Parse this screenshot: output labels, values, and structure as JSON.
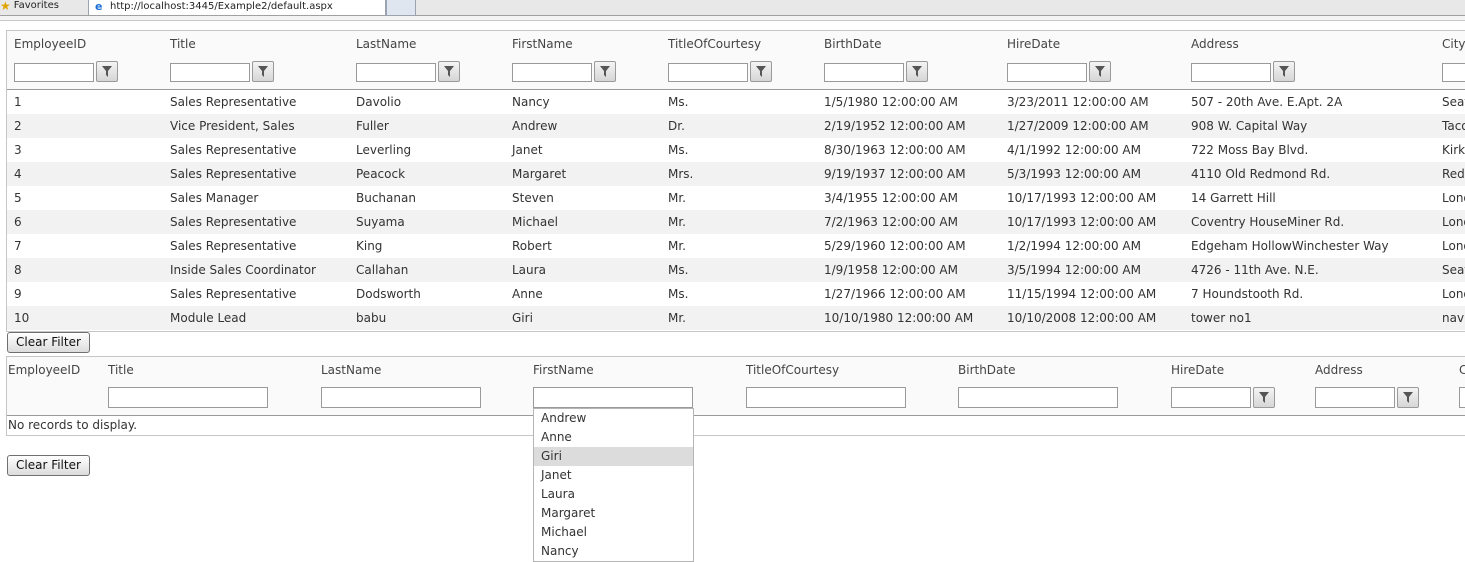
{
  "browser": {
    "favorites_label": "Favorites",
    "tab_url": "http://localhost:3445/Example2/default.aspx"
  },
  "grid1": {
    "columns": [
      "EmployeeID",
      "Title",
      "LastName",
      "FirstName",
      "TitleOfCourtesy",
      "BirthDate",
      "HireDate",
      "Address",
      "City"
    ],
    "rows": [
      [
        "1",
        "Sales Representative",
        "Davolio",
        "Nancy",
        "Ms.",
        "1/5/1980 12:00:00 AM",
        "3/23/2011 12:00:00 AM",
        "507 - 20th Ave. E.Apt. 2A",
        "Seattle"
      ],
      [
        "2",
        "Vice President, Sales",
        "Fuller",
        "Andrew",
        "Dr.",
        "2/19/1952 12:00:00 AM",
        "1/27/2009 12:00:00 AM",
        "908 W. Capital Way",
        "Tacoma"
      ],
      [
        "3",
        "Sales Representative",
        "Leverling",
        "Janet",
        "Ms.",
        "8/30/1963 12:00:00 AM",
        "4/1/1992 12:00:00 AM",
        "722 Moss Bay Blvd.",
        "Kirkland"
      ],
      [
        "4",
        "Sales Representative",
        "Peacock",
        "Margaret",
        "Mrs.",
        "9/19/1937 12:00:00 AM",
        "5/3/1993 12:00:00 AM",
        "4110 Old Redmond Rd.",
        "Redmond"
      ],
      [
        "5",
        "Sales Manager",
        "Buchanan",
        "Steven",
        "Mr.",
        "3/4/1955 12:00:00 AM",
        "10/17/1993 12:00:00 AM",
        "14 Garrett Hill",
        "London"
      ],
      [
        "6",
        "Sales Representative",
        "Suyama",
        "Michael",
        "Mr.",
        "7/2/1963 12:00:00 AM",
        "10/17/1993 12:00:00 AM",
        "Coventry HouseMiner Rd.",
        "London"
      ],
      [
        "7",
        "Sales Representative",
        "King",
        "Robert",
        "Mr.",
        "5/29/1960 12:00:00 AM",
        "1/2/1994 12:00:00 AM",
        "Edgeham HollowWinchester Way",
        "London"
      ],
      [
        "8",
        "Inside Sales Coordinator",
        "Callahan",
        "Laura",
        "Ms.",
        "1/9/1958 12:00:00 AM",
        "3/5/1994 12:00:00 AM",
        "4726 - 11th Ave. N.E.",
        "Seattle"
      ],
      [
        "9",
        "Sales Representative",
        "Dodsworth",
        "Anne",
        "Ms.",
        "1/27/1966 12:00:00 AM",
        "11/15/1994 12:00:00 AM",
        "7 Houndstooth Rd.",
        "London"
      ],
      [
        "10",
        "Module Lead",
        "babu",
        "Giri",
        "Mr.",
        "10/10/1980 12:00:00 AM",
        "10/10/2008 12:00:00 AM",
        "tower no1",
        "navi"
      ]
    ]
  },
  "clear_filter_label": "Clear Filter",
  "grid2": {
    "columns": [
      "EmployeeID",
      "Title",
      "LastName",
      "FirstName",
      "TitleOfCourtesy",
      "BirthDate",
      "HireDate",
      "Address",
      "City"
    ],
    "no_records": "No records to display."
  },
  "dropdown": {
    "items": [
      "Andrew",
      "Anne",
      "Giri",
      "Janet",
      "Laura",
      "Margaret",
      "Michael",
      "Nancy"
    ],
    "selected": "Giri"
  },
  "icons": {
    "filter": "filter-icon",
    "favorites": "star-icon",
    "tab": "ie-icon"
  },
  "colors": {
    "header_bg": "#fafafa",
    "alt_row": "#f2f2f2",
    "dropdown_selected": "#dcdcdc",
    "favorites_star": "#e2a400"
  }
}
